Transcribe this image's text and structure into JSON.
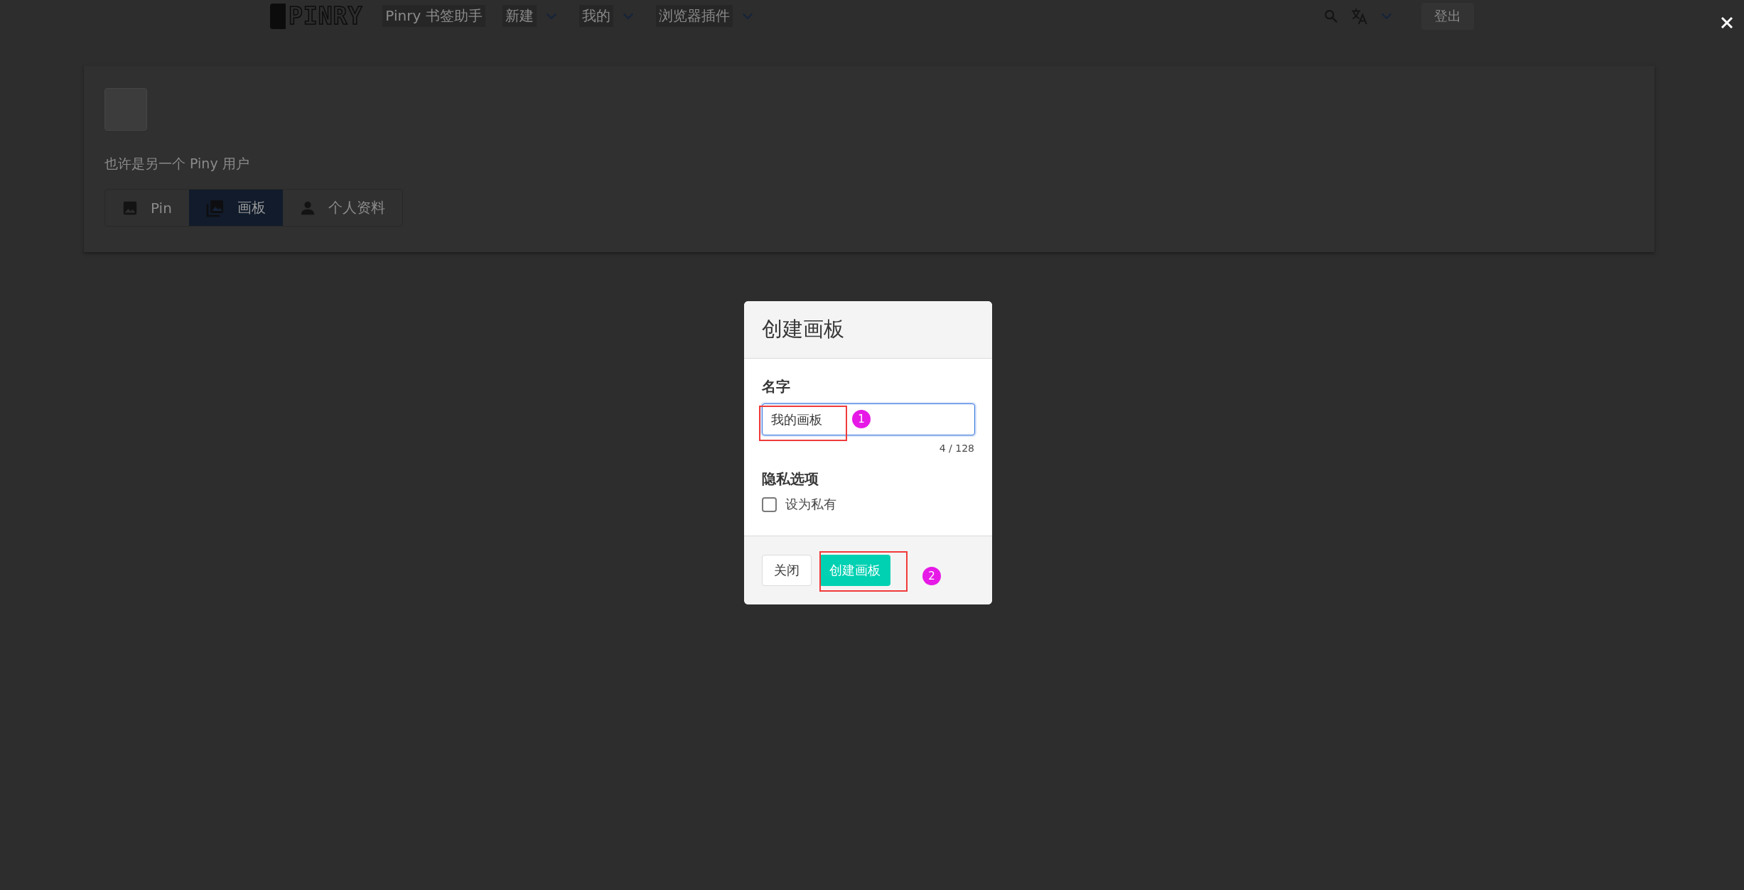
{
  "nav": {
    "logo": "PINRY",
    "items": [
      {
        "label": "Pinry 书签助手",
        "dropdown": false
      },
      {
        "label": "新建",
        "dropdown": true
      },
      {
        "label": "我的",
        "dropdown": true
      },
      {
        "label": "浏览器插件",
        "dropdown": true
      }
    ],
    "logout": "登出"
  },
  "profile": {
    "description": "也许是另一个 Piny 用户",
    "tabs": [
      {
        "label": "Pin",
        "selected": false
      },
      {
        "label": "画板",
        "selected": true
      },
      {
        "label": "个人资料",
        "selected": false
      }
    ]
  },
  "modal": {
    "title": "创建画板",
    "name_label": "名字",
    "name_value": "我的画板",
    "counter": "4 / 128",
    "privacy_label": "隐私选项",
    "private_checkbox": {
      "label": "设为私有",
      "checked": false
    },
    "buttons": [
      {
        "label": "关闭",
        "kind": "secondary"
      },
      {
        "label": "创建画板",
        "kind": "primary"
      }
    ]
  },
  "annotations": [
    {
      "label": "1"
    },
    {
      "label": "2"
    }
  ]
}
